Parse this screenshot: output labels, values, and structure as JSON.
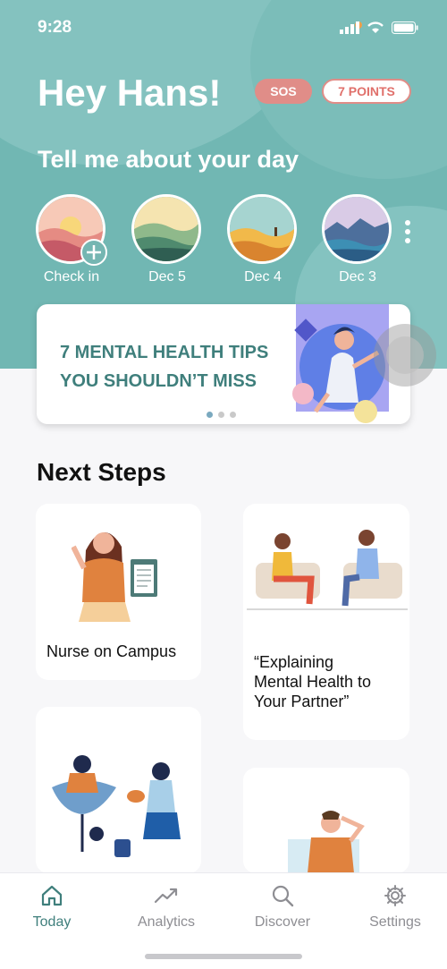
{
  "status": {
    "time": "9:28"
  },
  "header": {
    "greeting": "Hey Hans!",
    "sos_label": "SOS",
    "points_label": "7 POINTS",
    "prompt": "Tell me about your day"
  },
  "days": [
    {
      "label": "Check in"
    },
    {
      "label": "Dec 5"
    },
    {
      "label": "Dec 4"
    },
    {
      "label": "Dec 3"
    }
  ],
  "banner": {
    "line1": "7 MENTAL HEALTH TIPS",
    "line2": "YOU SHOULDN’T MISS",
    "page_count": 3,
    "active_page": 1
  },
  "next_steps": {
    "title": "Next Steps",
    "cards": [
      {
        "title": "Nurse on Campus"
      },
      {
        "line1": "“Explaining",
        "line2": "Mental Health to",
        "line3": "Your Partner”"
      }
    ]
  },
  "tabs": [
    {
      "label": "Today",
      "icon": "home-icon",
      "active": true
    },
    {
      "label": "Analytics",
      "icon": "trend-icon"
    },
    {
      "label": "Discover",
      "icon": "search-icon"
    },
    {
      "label": "Settings",
      "icon": "gear-icon"
    }
  ],
  "colors": {
    "teal": "#71b7b3",
    "accent": "#e08d88",
    "text_teal": "#3f7f7c"
  }
}
